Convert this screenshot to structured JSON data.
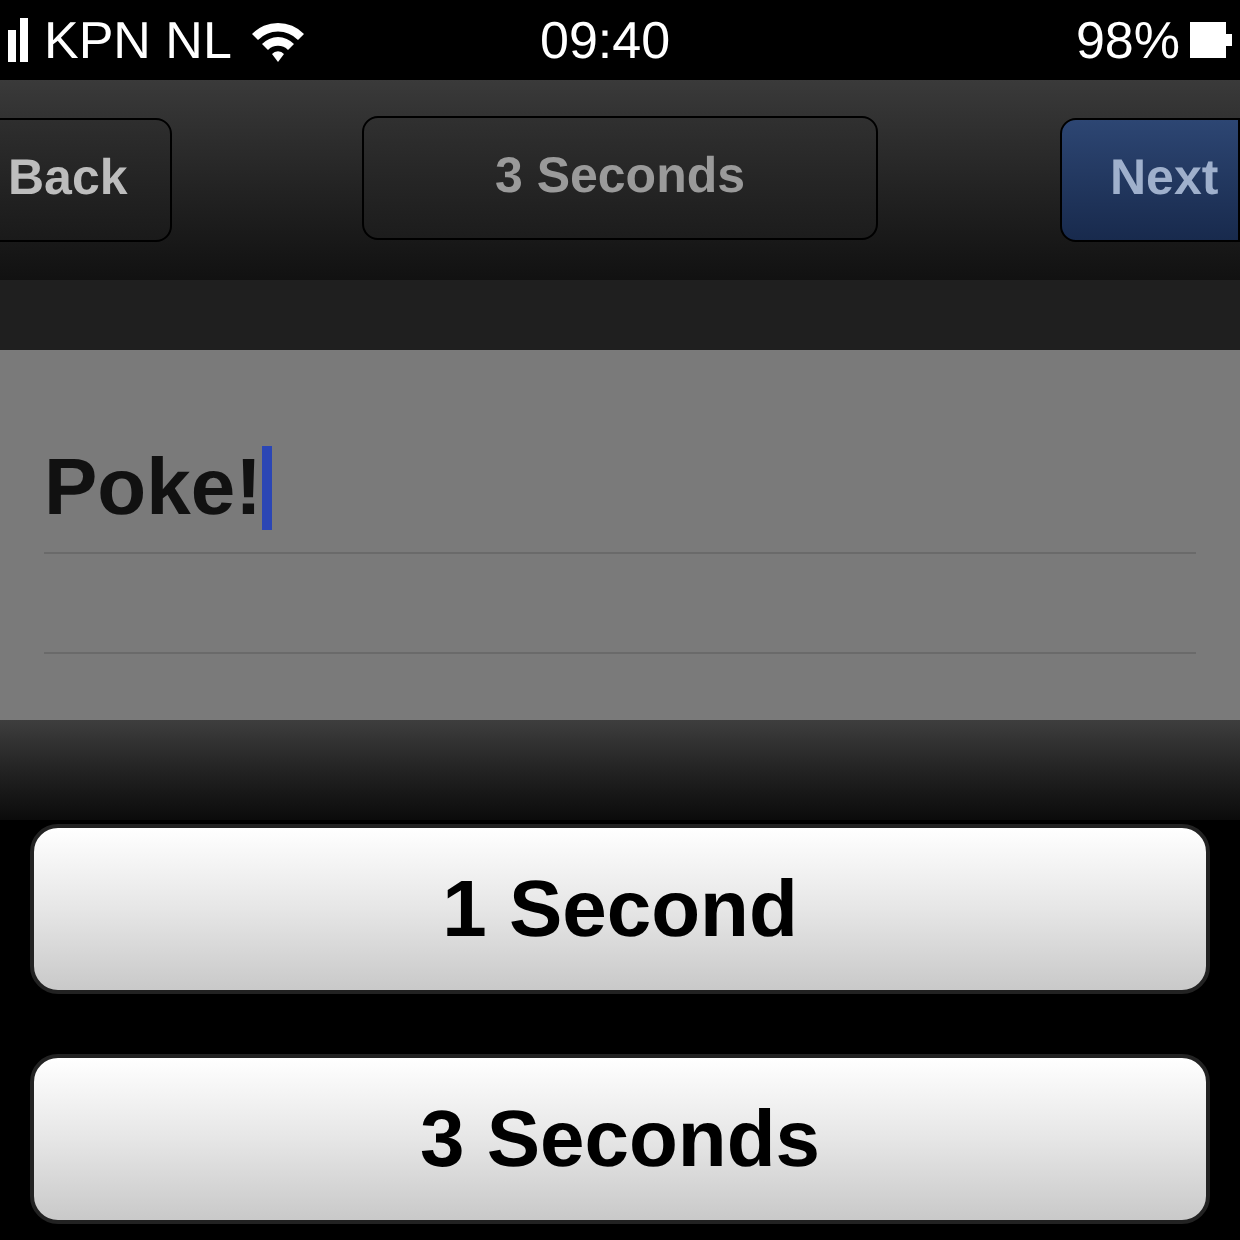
{
  "status_bar": {
    "carrier": "KPN NL",
    "time": "09:40",
    "battery": "98%"
  },
  "nav_bar": {
    "back": "Back",
    "title": "3 Seconds",
    "next": "Next"
  },
  "note": {
    "value": "Poke!",
    "focused": true
  },
  "action_sheet": {
    "buttons": [
      {
        "label": "1 Second"
      },
      {
        "label": "3 Seconds"
      }
    ]
  }
}
